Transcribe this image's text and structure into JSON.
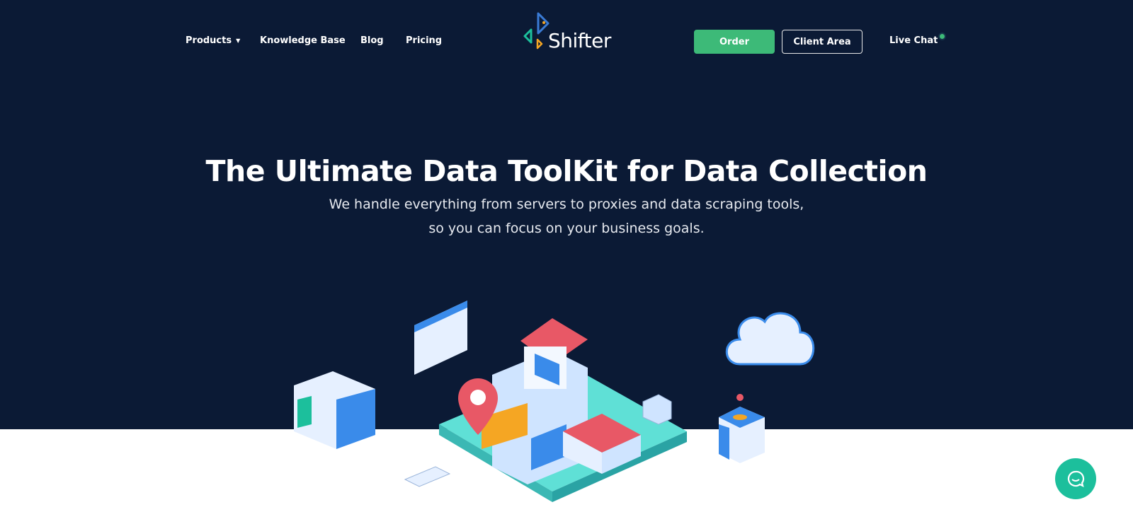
{
  "nav": {
    "items": [
      {
        "label": "Products",
        "has_dropdown": true
      },
      {
        "label": "Knowledge Base"
      },
      {
        "label": "Blog"
      },
      {
        "label": "Pricing"
      }
    ],
    "logo_text": "Shifter",
    "order_label": "Order",
    "client_area_label": "Client Area",
    "live_chat_label": "Live Chat",
    "live_chat_status": "online"
  },
  "hero": {
    "title": "The Ultimate Data ToolKit for Data Collection",
    "subtitle_line1": "We handle everything from servers to proxies and data scraping tools,",
    "subtitle_line2": "so you can focus on your business goals."
  },
  "colors": {
    "background": "#0b1a35",
    "accent": "#3dba78",
    "chat": "#1cbf9c"
  },
  "icons": {
    "caret": "caret-down-icon",
    "chat": "chat-bubble-icon"
  }
}
